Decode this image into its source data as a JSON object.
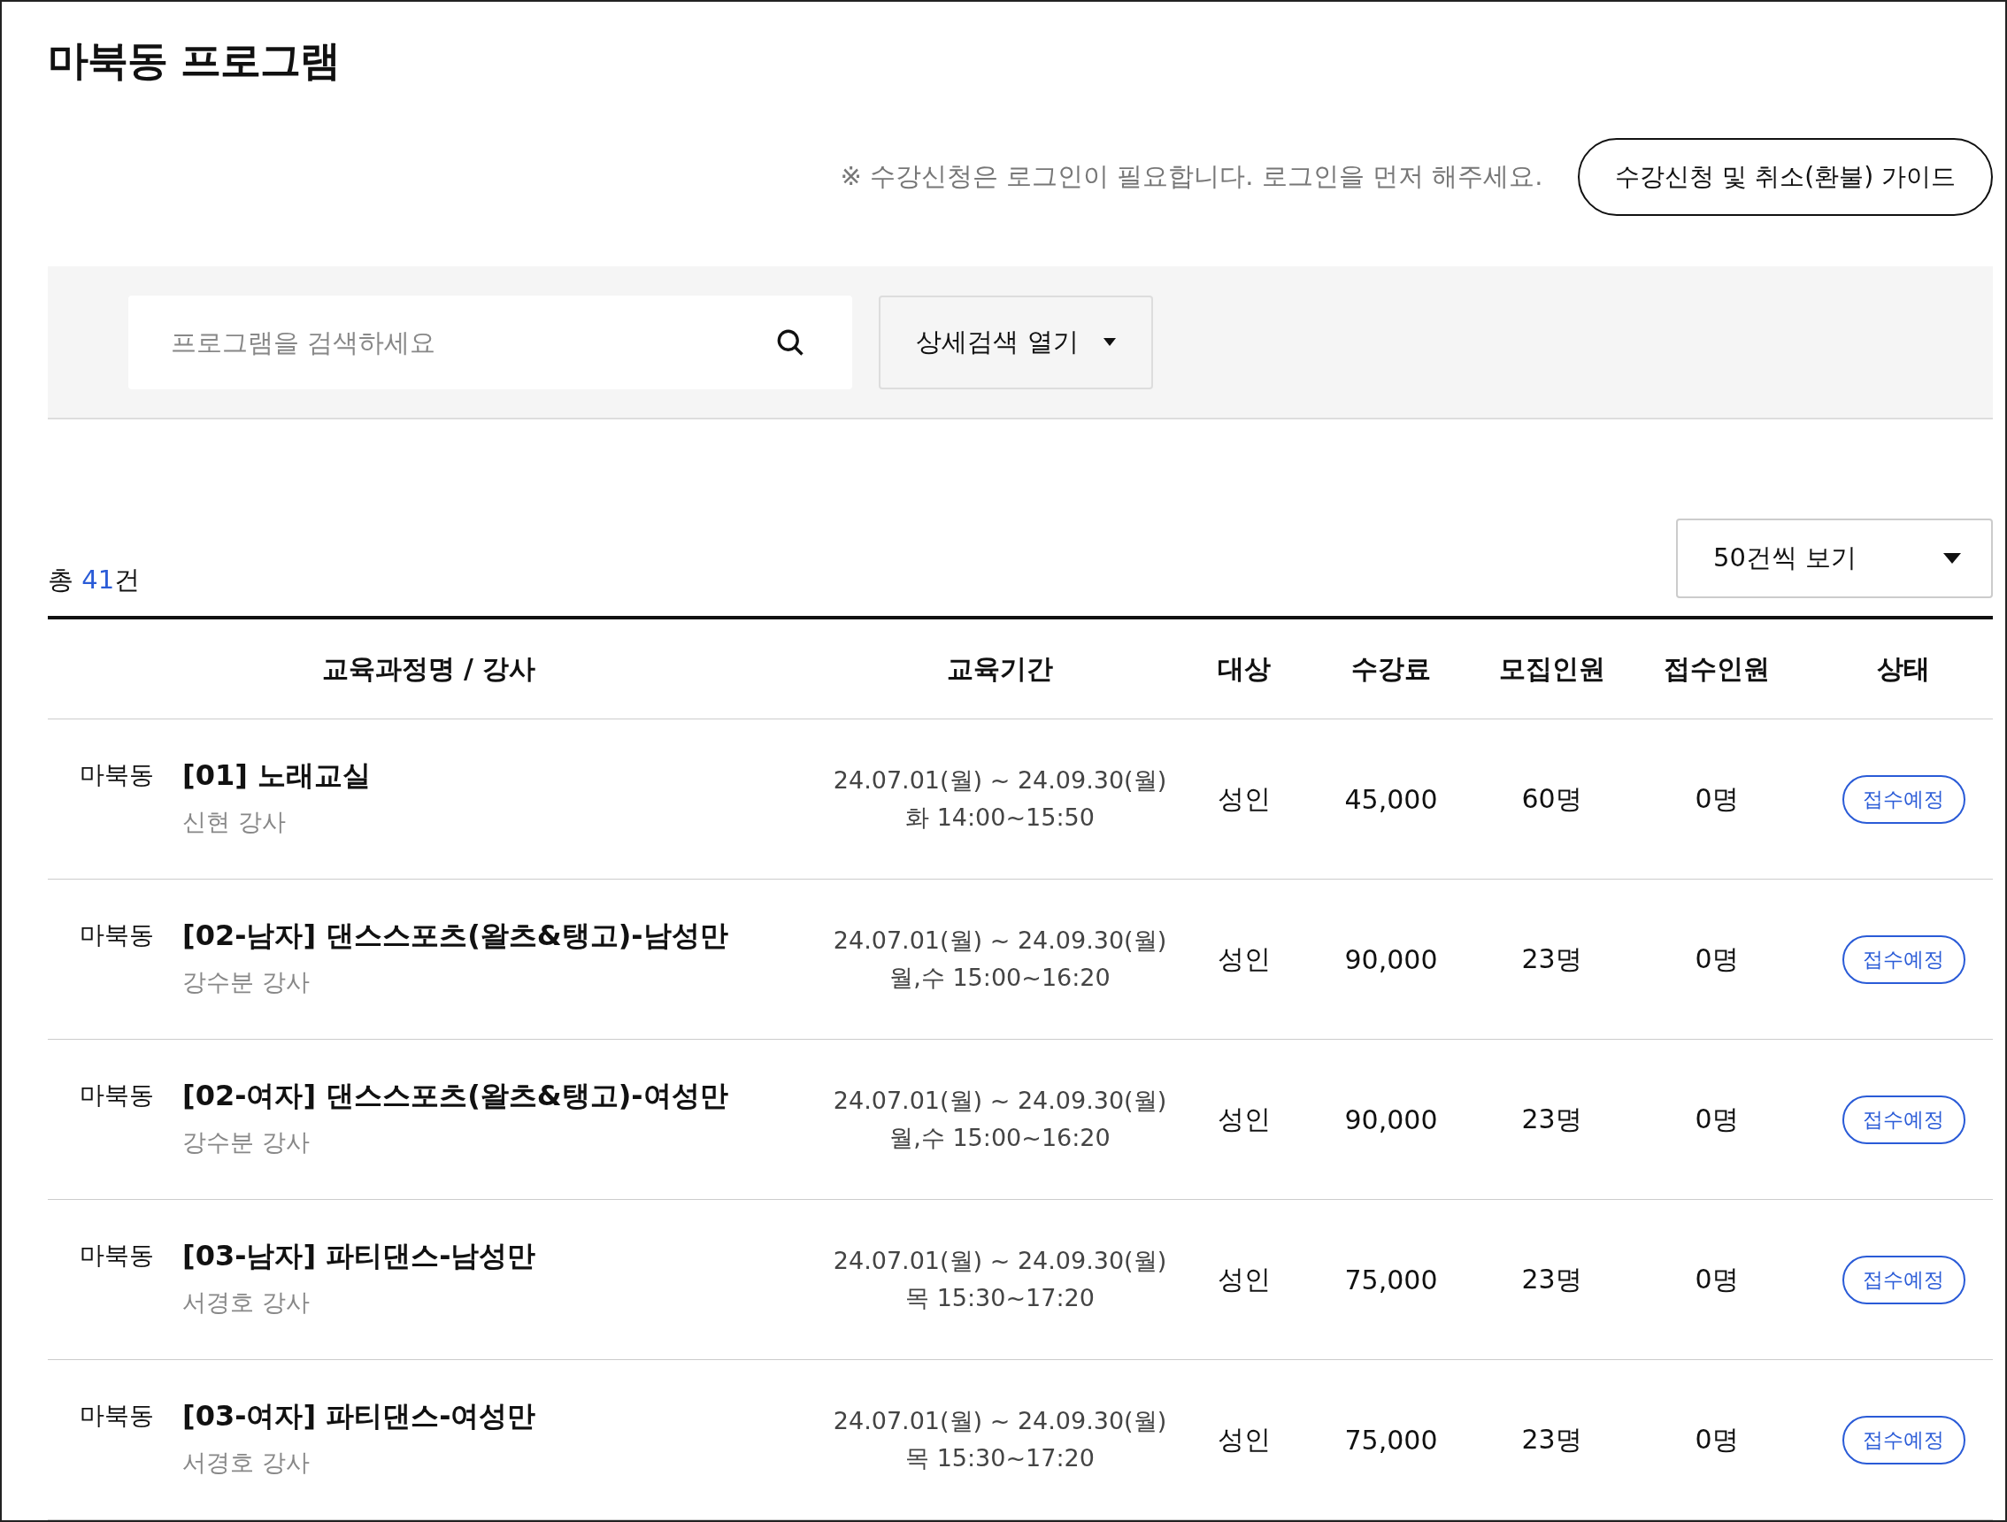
{
  "title": "마북동 프로그램",
  "notice": "※ 수강신청은 로그인이 필요합니다. 로그인을 먼저 해주세요.",
  "guide_button": "수강신청 및 취소(환불) 가이드",
  "search": {
    "placeholder": "프로그램을 검색하세요",
    "detail_button": "상세검색 열기"
  },
  "total": {
    "prefix": "총",
    "count": "41",
    "suffix": "건"
  },
  "page_size": "50건씩 보기",
  "table": {
    "columns": [
      "교육과정명 / 강사",
      "교육기간",
      "대상",
      "수강료",
      "모집인원",
      "접수인원",
      "상태"
    ],
    "rows": [
      {
        "location": "마북동",
        "title": "[01] 노래교실",
        "instructor": "신현 강사",
        "period": "24.07.01(월) ~ 24.09.30(월)",
        "schedule": "화 14:00~15:50",
        "target": "성인",
        "fee": "45,000",
        "capacity": "60명",
        "applied": "0명",
        "status": "접수예정"
      },
      {
        "location": "마북동",
        "title": "[02-남자] 댄스스포츠(왈츠&탱고)-남성만",
        "instructor": "강수분 강사",
        "period": "24.07.01(월) ~ 24.09.30(월)",
        "schedule": "월,수 15:00~16:20",
        "target": "성인",
        "fee": "90,000",
        "capacity": "23명",
        "applied": "0명",
        "status": "접수예정"
      },
      {
        "location": "마북동",
        "title": "[02-여자] 댄스스포츠(왈츠&탱고)-여성만",
        "instructor": "강수분 강사",
        "period": "24.07.01(월) ~ 24.09.30(월)",
        "schedule": "월,수 15:00~16:20",
        "target": "성인",
        "fee": "90,000",
        "capacity": "23명",
        "applied": "0명",
        "status": "접수예정"
      },
      {
        "location": "마북동",
        "title": "[03-남자] 파티댄스-남성만",
        "instructor": "서경호 강사",
        "period": "24.07.01(월) ~ 24.09.30(월)",
        "schedule": "목 15:30~17:20",
        "target": "성인",
        "fee": "75,000",
        "capacity": "23명",
        "applied": "0명",
        "status": "접수예정"
      },
      {
        "location": "마북동",
        "title": "[03-여자] 파티댄스-여성만",
        "instructor": "서경호 강사",
        "period": "24.07.01(월) ~ 24.09.30(월)",
        "schedule": "목 15:30~17:20",
        "target": "성인",
        "fee": "75,000",
        "capacity": "23명",
        "applied": "0명",
        "status": "접수예정"
      }
    ]
  }
}
